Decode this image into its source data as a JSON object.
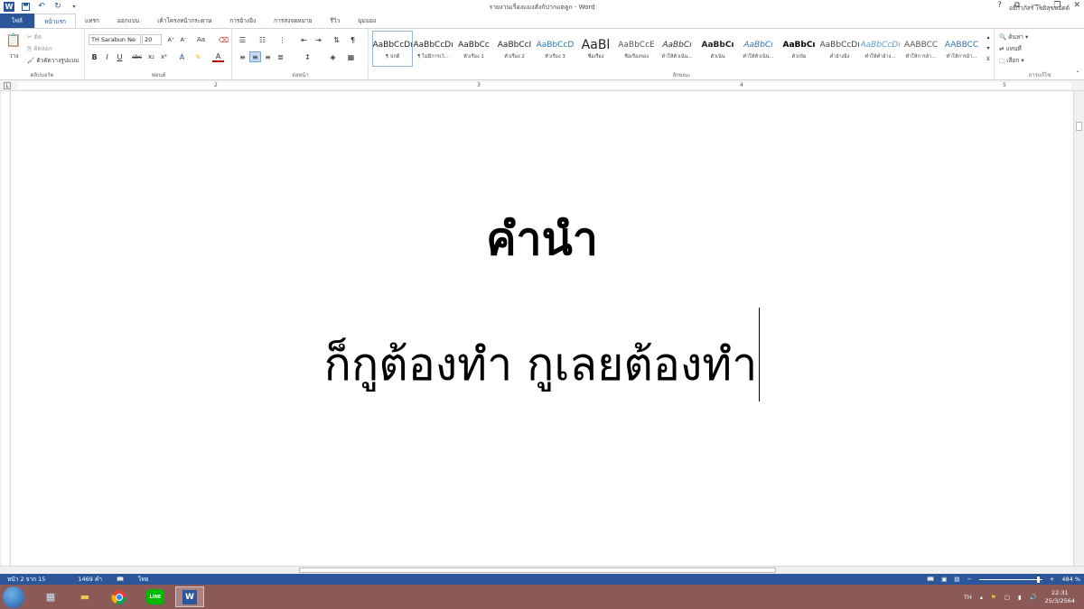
{
  "window": {
    "title": "รายงานเรื่องแมงสังกัปากแตลูก - Word",
    "help": "?",
    "minimize": "—",
    "restore": "❐",
    "close": "✕"
  },
  "quick_access": {
    "save_icon": "save-icon",
    "undo_icon": "undo-icon",
    "redo_icon": "redo-icon"
  },
  "tabs": [
    {
      "label": "ไฟล์",
      "kind": "file"
    },
    {
      "label": "หน้าแรก",
      "kind": "active"
    },
    {
      "label": "แทรก"
    },
    {
      "label": "ออกแบบ"
    },
    {
      "label": "เค้าโครงหน้ากระดาษ"
    },
    {
      "label": "การอ้างอิง"
    },
    {
      "label": "การส่งจดหมาย"
    },
    {
      "label": "รีวิว"
    },
    {
      "label": "มุมมอง"
    }
  ],
  "user_name": "อธิกาภัสร์ โชติสุขพนัดต์",
  "ribbon": {
    "clipboard": {
      "paste": "วาง",
      "cut": "ตัด",
      "copy": "คัดลอก",
      "format_painter": "ตัวคัดวางรูปแบบ",
      "label": "คลิปบอร์ด"
    },
    "font": {
      "name": "TH Sarabun Ne",
      "size": "20",
      "label": "ฟอนต์",
      "bold": "B",
      "italic": "I",
      "underline": "U",
      "strike": "abc",
      "subscript": "x₂",
      "superscript": "x²",
      "grow": "A⁺",
      "shrink": "A⁻",
      "case": "Aa",
      "font_color": "A"
    },
    "paragraph": {
      "label": "ย่อหน้า",
      "pilcrow": "¶"
    },
    "styles": {
      "label": "ลักษณะ",
      "items": [
        {
          "sample": "AaBbCcDı",
          "name": "¶ ปกติ",
          "selected": true
        },
        {
          "sample": "AaBbCcDı",
          "name": "¶ ไม่มีการเว้..."
        },
        {
          "sample": "AaBbCc",
          "name": "หัวเรื่อง 1"
        },
        {
          "sample": "AaBbCcI",
          "name": "หัวเรื่อง 2"
        },
        {
          "sample": "AaBbCcD",
          "name": "หัวเรื่อง 3"
        },
        {
          "sample": "AaBl",
          "name": "ชื่อเรื่อง"
        },
        {
          "sample": "AaBbCcE",
          "name": "ชื่อเรื่องรอง"
        },
        {
          "sample": "AaBbCı",
          "name": "ทำให้ตัวเน้น..."
        },
        {
          "sample": "AaBbCı",
          "name": "ตัวเน้น"
        },
        {
          "sample": "AaBbCı",
          "name": "ทำให้ตัวเน้น..."
        },
        {
          "sample": "AaBbCı",
          "name": "ตัวเข้ม"
        },
        {
          "sample": "AaBbCcDı",
          "name": "คำอ้างอิง"
        },
        {
          "sample": "AaBbCcDı",
          "name": "ทำให้คำอ้าง..."
        },
        {
          "sample": "AABBCC",
          "name": "ทำให้การอ้า..."
        },
        {
          "sample": "AABBCC",
          "name": "ทำให้การอ้า..."
        }
      ]
    },
    "editing": {
      "label": "การแก้ไข",
      "find": "ค้นหา",
      "replace": "แทนที่",
      "select": "เลือก"
    }
  },
  "ruler": {
    "marks": [
      "2",
      "3",
      "4",
      "5"
    ]
  },
  "document": {
    "heading": "คำนำ",
    "body": "ก็กูต้องทำ กูเลยต้องทำ"
  },
  "statusbar": {
    "page": "หน้า 2 จาก 15",
    "words": "1469 คำ",
    "language": "ไทย",
    "zoom": "484 %",
    "zoom_minus": "−",
    "zoom_plus": "+"
  },
  "taskbar": {
    "line_label": "LINE",
    "word_label": "W",
    "language": "TH",
    "time": "22:31",
    "date": "25/3/2564"
  },
  "colors": {
    "accent": "#2b579a",
    "taskbar": "#8b5a57"
  }
}
